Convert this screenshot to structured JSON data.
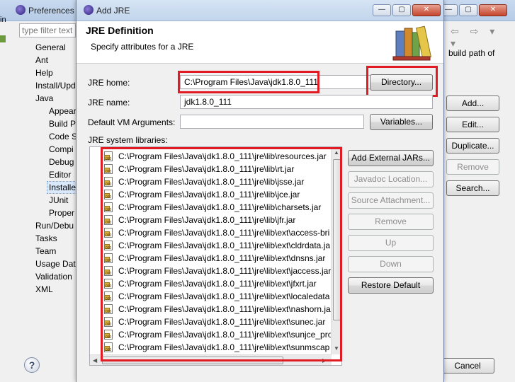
{
  "preferences": {
    "title": "Preferences",
    "filter_placeholder": "type filter text",
    "left_edge_label": "in",
    "tree": [
      "General",
      "Ant",
      "Help",
      "Install/Upd",
      "Java",
      "Appear",
      "Build P",
      "Code S",
      "Compi",
      "Debug",
      "Editor",
      "Installe",
      "JUnit",
      "Proper",
      "Run/Debu",
      "Tasks",
      "Team",
      "Usage Data",
      "Validation",
      "XML"
    ],
    "right_text": "build path of",
    "nav_arrows": "⇦ ⇨ ▾ ▾",
    "buttons": {
      "add": "Add...",
      "edit": "Edit...",
      "duplicate": "Duplicate...",
      "remove": "Remove",
      "search": "Search...",
      "cancel": "Cancel"
    }
  },
  "dialog": {
    "title": "Add JRE",
    "header_title": "JRE Definition",
    "header_description": "Specify attributes for a JRE",
    "jre_home_label": "JRE home:",
    "jre_home_value": "C:\\Program Files\\Java\\jdk1.8.0_111",
    "directory_button": "Directory...",
    "jre_name_label": "JRE name:",
    "jre_name_value": "jdk1.8.0_111",
    "vm_args_label": "Default VM Arguments:",
    "vm_args_value": "",
    "variables_button": "Variables...",
    "libraries_label": "JRE system libraries:",
    "libraries": [
      "C:\\Program Files\\Java\\jdk1.8.0_111\\jre\\lib\\resources.jar",
      "C:\\Program Files\\Java\\jdk1.8.0_111\\jre\\lib\\rt.jar",
      "C:\\Program Files\\Java\\jdk1.8.0_111\\jre\\lib\\jsse.jar",
      "C:\\Program Files\\Java\\jdk1.8.0_111\\jre\\lib\\jce.jar",
      "C:\\Program Files\\Java\\jdk1.8.0_111\\jre\\lib\\charsets.jar",
      "C:\\Program Files\\Java\\jdk1.8.0_111\\jre\\lib\\jfr.jar",
      "C:\\Program Files\\Java\\jdk1.8.0_111\\jre\\lib\\ext\\access-bri",
      "C:\\Program Files\\Java\\jdk1.8.0_111\\jre\\lib\\ext\\cldrdata.ja",
      "C:\\Program Files\\Java\\jdk1.8.0_111\\jre\\lib\\ext\\dnsns.jar",
      "C:\\Program Files\\Java\\jdk1.8.0_111\\jre\\lib\\ext\\jaccess.jar",
      "C:\\Program Files\\Java\\jdk1.8.0_111\\jre\\lib\\ext\\jfxrt.jar",
      "C:\\Program Files\\Java\\jdk1.8.0_111\\jre\\lib\\ext\\localedata",
      "C:\\Program Files\\Java\\jdk1.8.0_111\\jre\\lib\\ext\\nashorn.ja",
      "C:\\Program Files\\Java\\jdk1.8.0_111\\jre\\lib\\ext\\sunec.jar",
      "C:\\Program Files\\Java\\jdk1.8.0_111\\jre\\lib\\ext\\sunjce_pro",
      "C:\\Program Files\\Java\\jdk1.8.0_111\\jre\\lib\\ext\\sunmscap"
    ],
    "side_buttons": {
      "add_external_jars": "Add External JARs...",
      "javadoc_location": "Javadoc Location...",
      "source_attachment": "Source Attachment...",
      "remove": "Remove",
      "up": "Up",
      "down": "Down",
      "restore_default": "Restore Default"
    },
    "window_buttons": {
      "minimize": "—",
      "maximize": "▢",
      "close": "✕"
    }
  },
  "colors": {
    "highlight": "#e01b24",
    "selection": "#d9e8fb"
  },
  "icons": [
    "eclipse-icon",
    "books-icon",
    "jar-icon",
    "help-icon"
  ]
}
